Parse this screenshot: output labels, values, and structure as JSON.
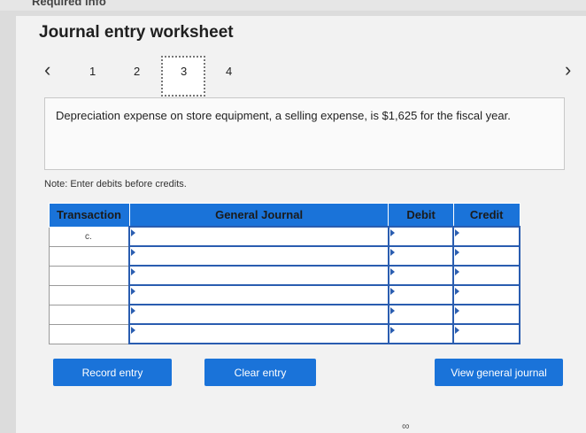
{
  "header": {
    "cut_text": "Required info"
  },
  "title": "Journal entry worksheet",
  "nav": {
    "prev_icon": "chevron-left-icon",
    "next_icon": "chevron-right-icon",
    "pages": [
      "1",
      "2",
      "3",
      "4"
    ],
    "active_page": "3"
  },
  "description": "Depreciation expense on store equipment, a selling expense, is $1,625 for the fiscal year.",
  "note": "Note: Enter debits before credits.",
  "journal": {
    "columns": [
      "Transaction",
      "General Journal",
      "Debit",
      "Credit"
    ],
    "rows": [
      {
        "transaction": "c.",
        "account": "",
        "debit": "",
        "credit": ""
      },
      {
        "transaction": "",
        "account": "",
        "debit": "",
        "credit": ""
      },
      {
        "transaction": "",
        "account": "",
        "debit": "",
        "credit": ""
      },
      {
        "transaction": "",
        "account": "",
        "debit": "",
        "credit": ""
      },
      {
        "transaction": "",
        "account": "",
        "debit": "",
        "credit": ""
      },
      {
        "transaction": "",
        "account": "",
        "debit": "",
        "credit": ""
      }
    ]
  },
  "buttons": {
    "record": "Record entry",
    "clear": "Clear entry",
    "view": "View general journal"
  },
  "colors": {
    "accent": "#1a73d9",
    "input_border": "#2a5db0"
  }
}
